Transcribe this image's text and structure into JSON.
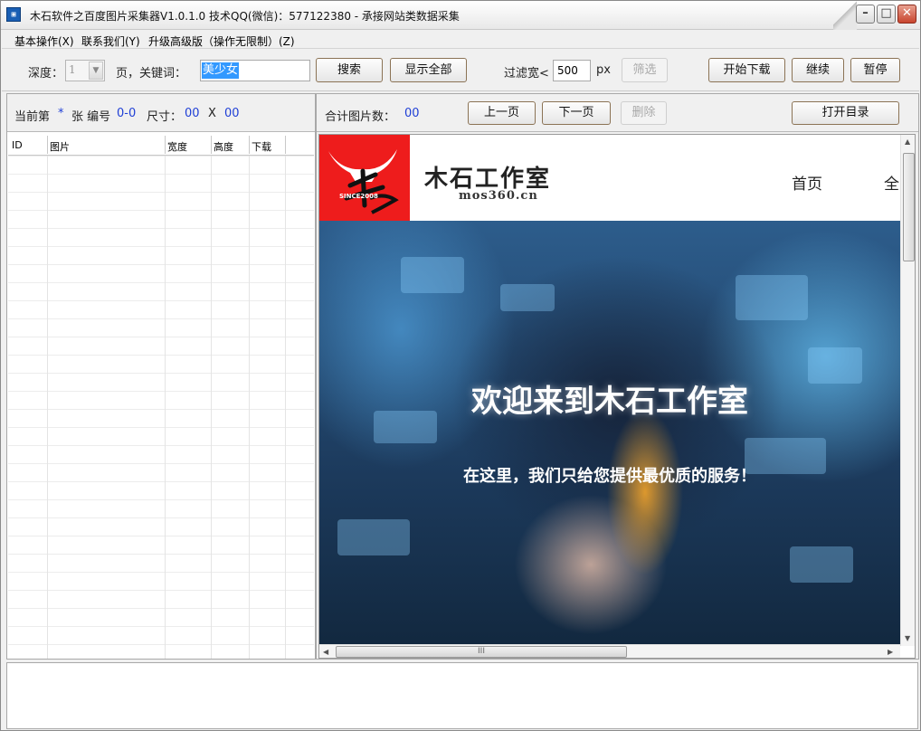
{
  "window": {
    "title": "木石软件之百度图片采集器V1.0.1.0  技术QQ(微信)：577122380    - 承接网站类数据采集",
    "icon": "app-icon",
    "controls": {
      "minimize": "minimize-icon",
      "maximize": "maximize-icon",
      "close": "close-icon"
    }
  },
  "menu": [
    {
      "label": "基本操作(X)"
    },
    {
      "label": "联系我们(Y)"
    },
    {
      "label": "升级高级版（操作无限制）(Z)"
    }
  ],
  "toolbar": {
    "depth_label": "深度：",
    "depth_value": "1",
    "keyword_label": "页，关键词：",
    "keyword_value": "美少女",
    "search_button": "搜索",
    "show_all_button": "显示全部",
    "filter_label": "过滤宽<",
    "filter_width_value": "500",
    "filter_unit": "px",
    "filter_button": "筛选",
    "start_download_button": "开始下载",
    "continue_button": "继续",
    "pause_button": "暂停"
  },
  "left_info": {
    "current_prefix": "当前第",
    "current_value": "*",
    "index_label": "张 编号",
    "index_value": "0-0",
    "size_label": "尺寸：",
    "size_w": "00",
    "size_x": "X",
    "size_h": "00"
  },
  "right_info": {
    "total_label": "合计图片数：",
    "total_value": "00",
    "prev_button": "上一页",
    "next_button": "下一页",
    "delete_button": "删除",
    "open_dir_button": "打开目录"
  },
  "table": {
    "columns": [
      "ID",
      "图片",
      "宽度",
      "高度",
      "下载"
    ],
    "rows": []
  },
  "browser": {
    "site_name": "木石工作室",
    "site_url": "mos360.cn",
    "logo_text": "SINCE2008",
    "nav": [
      "首页",
      "全"
    ],
    "banner_title": "欢迎来到木石工作室",
    "banner_subtitle": "在这里，我们只给您提供最优质的服务！",
    "hscroll_grip": "III"
  },
  "colors": {
    "accent_blue": "#1f3fd6",
    "logo_red": "#ee1c1c",
    "selection_blue": "#3399ff"
  }
}
